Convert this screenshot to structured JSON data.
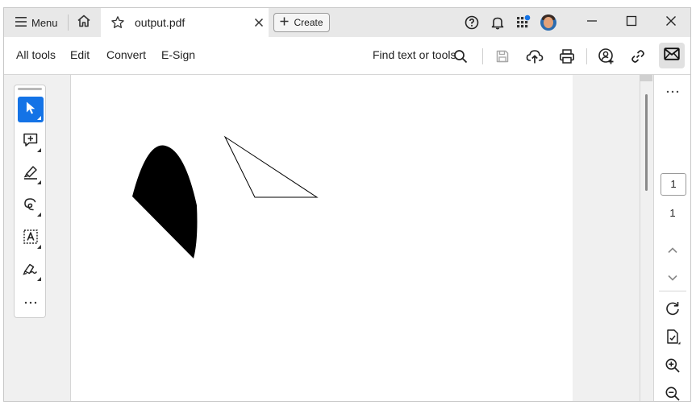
{
  "titlebar": {
    "menu_label": "Menu",
    "tab_title": "output.pdf",
    "create_label": "Create"
  },
  "toolbar": {
    "items": [
      "All tools",
      "Edit",
      "Convert",
      "E-Sign"
    ],
    "find_label": "Find text or tools"
  },
  "pager": {
    "current_page": "1",
    "total_pages": "1"
  },
  "icons": {
    "menu": "hamburger-icon",
    "home": "home-icon",
    "favorite": "star-icon",
    "close_tab": "close-icon",
    "help": "help-icon",
    "notifications": "bell-icon",
    "apps": "apps-grid-icon",
    "search": "search-icon",
    "save": "save-icon",
    "upload": "cloud-upload-icon",
    "print": "print-icon",
    "share": "share-user-icon",
    "link": "link-icon",
    "email": "email-icon"
  },
  "colors": {
    "accent": "#1473e6",
    "apps_badge": "#1473e6"
  }
}
